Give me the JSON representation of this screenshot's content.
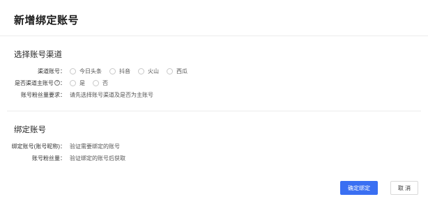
{
  "page": {
    "title": "新增绑定账号"
  },
  "section_channel": {
    "title": "选择账号渠道",
    "channel_row": {
      "label": "渠道账号：",
      "options": [
        "今日头条",
        "抖音",
        "火山",
        "西瓜"
      ]
    },
    "main_account_row": {
      "label": "是否渠道主账号",
      "help": "?",
      "colon": "：",
      "options": [
        "是",
        "否"
      ]
    },
    "fans_requirement_row": {
      "label": "账号粉丝量要求：",
      "value": "请先选择账号渠道及是否为主账号"
    }
  },
  "section_bind": {
    "title": "绑定账号",
    "account_row": {
      "label": "绑定账号(账号昵称)：",
      "link": "验证需要绑定的账号"
    },
    "fans_row": {
      "label": "账号粉丝量：",
      "value": "验证绑定的账号后获取"
    }
  },
  "actions": {
    "confirm_label": "确定绑定",
    "cancel_label": "取 消"
  },
  "colors": {
    "primary": "#3a6ff2",
    "link": "#3d6fe0"
  }
}
